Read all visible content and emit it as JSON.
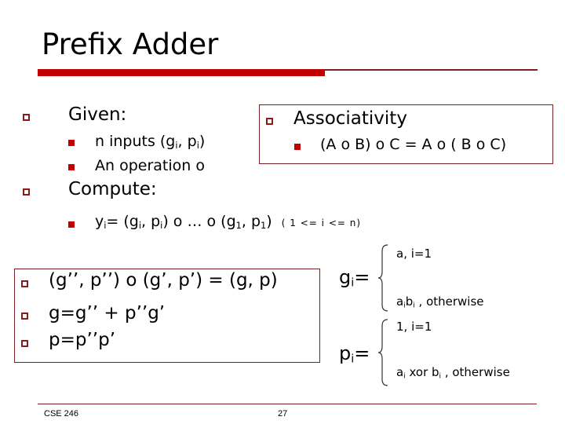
{
  "slide": {
    "title": "Prefix Adder",
    "accent_color": "#c00000",
    "border_color": "#7a1f24"
  },
  "given": {
    "heading": "Given:",
    "items": [
      {
        "pre": "n inputs (g",
        "sub1": "i",
        "mid": ", p",
        "sub2": "i",
        "post": ")"
      },
      {
        "text": "An operation o"
      }
    ]
  },
  "associativity": {
    "heading": "Associativity",
    "rule": "(A o B) o C = A o ( B o C)"
  },
  "compute": {
    "heading": "Compute:",
    "formula": {
      "y": "y",
      "ysub": "i",
      "eq": "= (g",
      "gsub": "i",
      "c1": ", p",
      "psub": "i",
      "c2": ") o … o (g",
      "g1sub": "1",
      "c3": ", p",
      "p1sub": "1",
      "c4": ")"
    },
    "range": "( 1 <= i <= n)"
  },
  "rules": [
    "(g’’, p’’) o (g’, p’) = (g, p)",
    "g=g’’ + p’’g’",
    "p=p’’p’"
  ],
  "g_def": {
    "lhs": "g",
    "lhs_sub": "i",
    "eq": "=",
    "case1": "a, i=1",
    "case2": {
      "a": "a",
      "asub": "i",
      "b": "b",
      "bsub": "i",
      "rest": " ,  otherwise"
    }
  },
  "p_def": {
    "lhs": "p",
    "lhs_sub": "i",
    "eq": "=",
    "case1": "1, i=1",
    "case2": {
      "a": "a",
      "asub": "i",
      "mid": " xor b",
      "bsub": "i",
      "rest": " , otherwise"
    }
  },
  "footer": {
    "course": "CSE 246",
    "page": "27"
  },
  "icons": {
    "level1_bullet": "hollow-square-icon",
    "level2_bullet": "solid-square-icon",
    "brace": "left-curly-brace-icon"
  }
}
